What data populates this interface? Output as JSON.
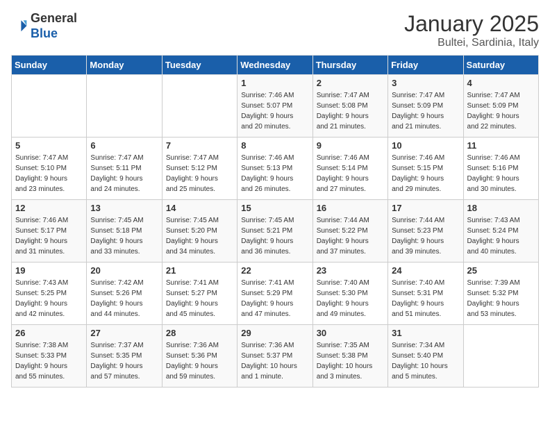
{
  "header": {
    "logo_general": "General",
    "logo_blue": "Blue",
    "title": "January 2025",
    "subtitle": "Bultei, Sardinia, Italy"
  },
  "days_of_week": [
    "Sunday",
    "Monday",
    "Tuesday",
    "Wednesday",
    "Thursday",
    "Friday",
    "Saturday"
  ],
  "weeks": [
    [
      {
        "day": "",
        "text": ""
      },
      {
        "day": "",
        "text": ""
      },
      {
        "day": "",
        "text": ""
      },
      {
        "day": "1",
        "text": "Sunrise: 7:46 AM\nSunset: 5:07 PM\nDaylight: 9 hours\nand 20 minutes."
      },
      {
        "day": "2",
        "text": "Sunrise: 7:47 AM\nSunset: 5:08 PM\nDaylight: 9 hours\nand 21 minutes."
      },
      {
        "day": "3",
        "text": "Sunrise: 7:47 AM\nSunset: 5:09 PM\nDaylight: 9 hours\nand 21 minutes."
      },
      {
        "day": "4",
        "text": "Sunrise: 7:47 AM\nSunset: 5:09 PM\nDaylight: 9 hours\nand 22 minutes."
      }
    ],
    [
      {
        "day": "5",
        "text": "Sunrise: 7:47 AM\nSunset: 5:10 PM\nDaylight: 9 hours\nand 23 minutes."
      },
      {
        "day": "6",
        "text": "Sunrise: 7:47 AM\nSunset: 5:11 PM\nDaylight: 9 hours\nand 24 minutes."
      },
      {
        "day": "7",
        "text": "Sunrise: 7:47 AM\nSunset: 5:12 PM\nDaylight: 9 hours\nand 25 minutes."
      },
      {
        "day": "8",
        "text": "Sunrise: 7:46 AM\nSunset: 5:13 PM\nDaylight: 9 hours\nand 26 minutes."
      },
      {
        "day": "9",
        "text": "Sunrise: 7:46 AM\nSunset: 5:14 PM\nDaylight: 9 hours\nand 27 minutes."
      },
      {
        "day": "10",
        "text": "Sunrise: 7:46 AM\nSunset: 5:15 PM\nDaylight: 9 hours\nand 29 minutes."
      },
      {
        "day": "11",
        "text": "Sunrise: 7:46 AM\nSunset: 5:16 PM\nDaylight: 9 hours\nand 30 minutes."
      }
    ],
    [
      {
        "day": "12",
        "text": "Sunrise: 7:46 AM\nSunset: 5:17 PM\nDaylight: 9 hours\nand 31 minutes."
      },
      {
        "day": "13",
        "text": "Sunrise: 7:45 AM\nSunset: 5:18 PM\nDaylight: 9 hours\nand 33 minutes."
      },
      {
        "day": "14",
        "text": "Sunrise: 7:45 AM\nSunset: 5:20 PM\nDaylight: 9 hours\nand 34 minutes."
      },
      {
        "day": "15",
        "text": "Sunrise: 7:45 AM\nSunset: 5:21 PM\nDaylight: 9 hours\nand 36 minutes."
      },
      {
        "day": "16",
        "text": "Sunrise: 7:44 AM\nSunset: 5:22 PM\nDaylight: 9 hours\nand 37 minutes."
      },
      {
        "day": "17",
        "text": "Sunrise: 7:44 AM\nSunset: 5:23 PM\nDaylight: 9 hours\nand 39 minutes."
      },
      {
        "day": "18",
        "text": "Sunrise: 7:43 AM\nSunset: 5:24 PM\nDaylight: 9 hours\nand 40 minutes."
      }
    ],
    [
      {
        "day": "19",
        "text": "Sunrise: 7:43 AM\nSunset: 5:25 PM\nDaylight: 9 hours\nand 42 minutes."
      },
      {
        "day": "20",
        "text": "Sunrise: 7:42 AM\nSunset: 5:26 PM\nDaylight: 9 hours\nand 44 minutes."
      },
      {
        "day": "21",
        "text": "Sunrise: 7:41 AM\nSunset: 5:27 PM\nDaylight: 9 hours\nand 45 minutes."
      },
      {
        "day": "22",
        "text": "Sunrise: 7:41 AM\nSunset: 5:29 PM\nDaylight: 9 hours\nand 47 minutes."
      },
      {
        "day": "23",
        "text": "Sunrise: 7:40 AM\nSunset: 5:30 PM\nDaylight: 9 hours\nand 49 minutes."
      },
      {
        "day": "24",
        "text": "Sunrise: 7:40 AM\nSunset: 5:31 PM\nDaylight: 9 hours\nand 51 minutes."
      },
      {
        "day": "25",
        "text": "Sunrise: 7:39 AM\nSunset: 5:32 PM\nDaylight: 9 hours\nand 53 minutes."
      }
    ],
    [
      {
        "day": "26",
        "text": "Sunrise: 7:38 AM\nSunset: 5:33 PM\nDaylight: 9 hours\nand 55 minutes."
      },
      {
        "day": "27",
        "text": "Sunrise: 7:37 AM\nSunset: 5:35 PM\nDaylight: 9 hours\nand 57 minutes."
      },
      {
        "day": "28",
        "text": "Sunrise: 7:36 AM\nSunset: 5:36 PM\nDaylight: 9 hours\nand 59 minutes."
      },
      {
        "day": "29",
        "text": "Sunrise: 7:36 AM\nSunset: 5:37 PM\nDaylight: 10 hours\nand 1 minute."
      },
      {
        "day": "30",
        "text": "Sunrise: 7:35 AM\nSunset: 5:38 PM\nDaylight: 10 hours\nand 3 minutes."
      },
      {
        "day": "31",
        "text": "Sunrise: 7:34 AM\nSunset: 5:40 PM\nDaylight: 10 hours\nand 5 minutes."
      },
      {
        "day": "",
        "text": ""
      }
    ]
  ]
}
